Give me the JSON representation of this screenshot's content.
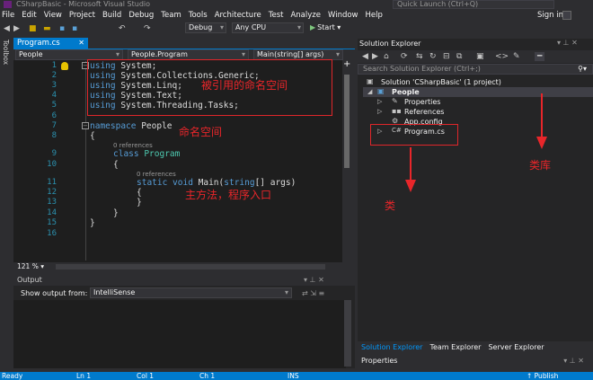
{
  "window": {
    "title": "CSharpBasic - Microsoft Visual Studio",
    "quick_launch_placeholder": "Quick Launch (Ctrl+Q)",
    "sign_in": "Sign in"
  },
  "menu": [
    "File",
    "Edit",
    "View",
    "Project",
    "Build",
    "Debug",
    "Team",
    "Tools",
    "Architecture",
    "Test",
    "Analyze",
    "Window",
    "Help"
  ],
  "toolbar": {
    "config": "Debug",
    "platform": "Any CPU",
    "start": "Start"
  },
  "toolbox_label": "Toolbox",
  "document_tab": {
    "label": "Program.cs",
    "close": "✕"
  },
  "navbar": {
    "project": "People",
    "class": "People.Program",
    "member": "Main(string[] args)"
  },
  "editor": {
    "line_numbers": [
      "1",
      "2",
      "3",
      "4",
      "5",
      "6",
      "7",
      "8",
      "9",
      "10",
      "11",
      "12",
      "13",
      "14",
      "15",
      "16"
    ],
    "lines": {
      "l1_kw": "using",
      "l1_rest": " System;",
      "l2_kw": "using",
      "l2_rest": " System.Collections.Generic;",
      "l3_kw": "using",
      "l3_rest": " System.Linq;",
      "l4_kw": "using",
      "l4_rest": " System.Text;",
      "l5_kw": "using",
      "l5_rest": " System.Threading.Tasks;",
      "l7_kw": "namespace",
      "l7_rest": " People",
      "l8": "{",
      "l9_kw": "class",
      "l9_ty": " Program",
      "l10": "{",
      "l11_kw": "static void",
      "l11_name": " Main(",
      "l11_kw2": "string",
      "l11_rest": "[] args)",
      "l12": "{",
      "l13": "}",
      "l14": "}",
      "l15": "}"
    },
    "refs_class": "0 references",
    "refs_main": "0 references",
    "zoom": "121 %"
  },
  "annotations": {
    "referenced_namespaces": "被引用的命名空间",
    "namespace": "命名空间",
    "main_method": "主方法，程序入口",
    "class": "类",
    "class_library": "类库"
  },
  "output": {
    "title": "Output",
    "show_from_label": "Show output from:",
    "source": "IntelliSense"
  },
  "solution_explorer": {
    "title": "Solution Explorer",
    "search_placeholder": "Search Solution Explorer (Ctrl+;)",
    "solution": "Solution 'CSharpBasic' (1 project)",
    "project": "People",
    "properties": "Properties",
    "references": "References",
    "app_config": "App.config",
    "program_cs": "Program.cs",
    "tabs": [
      "Solution Explorer",
      "Team Explorer",
      "Server Explorer"
    ]
  },
  "properties_panel": {
    "title": "Properties"
  },
  "status": {
    "ready": "Ready",
    "ln": "Ln 1",
    "col": "Col 1",
    "ch": "Ch 1",
    "ins": "INS",
    "publish": "↑ Publish"
  },
  "colors": {
    "accent": "#007acc",
    "annotation": "#e8262a",
    "keyword": "#569cd6",
    "type": "#4ec9b0"
  }
}
